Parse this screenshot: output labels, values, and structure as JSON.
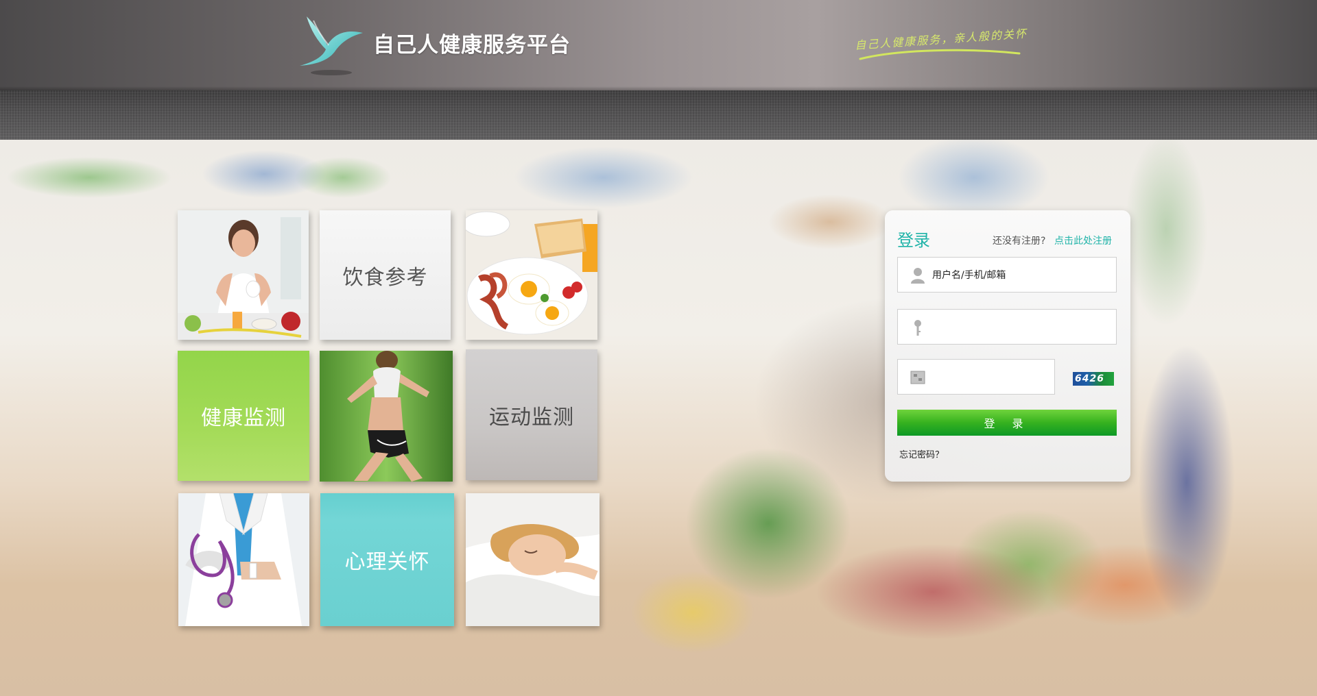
{
  "header": {
    "brand": "自己人健康服务平台",
    "slogan": "自己人健康服务，亲人般的关怀",
    "logo_icon": "dove-icon"
  },
  "tiles": [
    {
      "name": "woman-eating-image",
      "label": ""
    },
    {
      "name": "diet-reference",
      "label": "饮食参考"
    },
    {
      "name": "breakfast-plate-image",
      "label": ""
    },
    {
      "name": "health-monitoring",
      "label": "健康监测"
    },
    {
      "name": "woman-running-image",
      "label": ""
    },
    {
      "name": "exercise-monitoring",
      "label": "运动监测"
    },
    {
      "name": "doctor-stethoscope-image",
      "label": ""
    },
    {
      "name": "psychological-care",
      "label": "心理关怀"
    },
    {
      "name": "woman-sleeping-image",
      "label": ""
    }
  ],
  "login": {
    "title": "登录",
    "register_prompt": "还没有注册?",
    "register_link": "点击此处注册",
    "username_placeholder": "用户名/手机/邮箱",
    "password_placeholder": "",
    "captcha_placeholder": "",
    "captcha_code": "6426",
    "submit_label": "登 录",
    "forgot_password": "忘记密码？"
  },
  "colors": {
    "accent": "#1fb3a8",
    "button_green": "#36b21f",
    "health_tile": "#9fd94b",
    "care_tile": "#6fd2d2",
    "exercise_tile": "#c8c4c4"
  }
}
